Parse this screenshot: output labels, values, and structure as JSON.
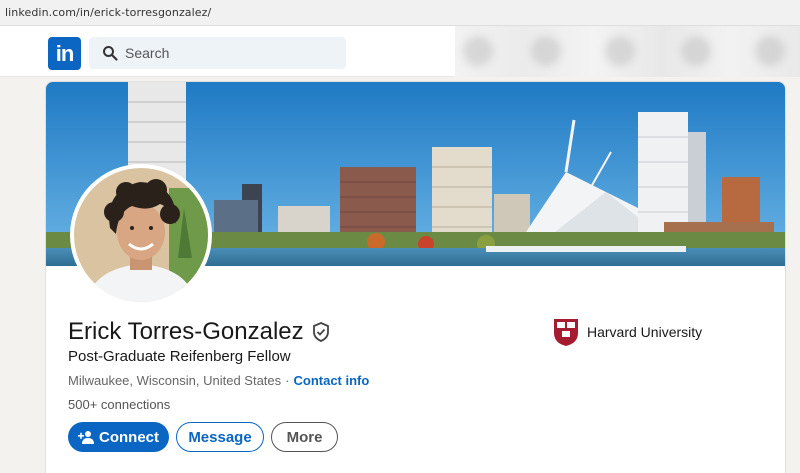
{
  "browser": {
    "url": "linkedin.com/in/erick-torresgonzalez/"
  },
  "navbar": {
    "logo_text": "in",
    "search": {
      "placeholder": "Search",
      "value": ""
    }
  },
  "profile": {
    "name": "Erick Torres-Gonzalez",
    "headline": "Post-Graduate Reifenberg Fellow",
    "location": "Milwaukee, Wisconsin, United States",
    "separator": "·",
    "contact_label": "Contact info",
    "connections": "500+ connections",
    "school": "Harvard University",
    "verified_icon": "verified-shield-icon"
  },
  "actions": {
    "connect_label": "Connect",
    "message_label": "Message",
    "more_label": "More"
  },
  "colors": {
    "brand": "#0a66c2",
    "background": "#f4f2ee",
    "harvard": "#a51c30"
  }
}
